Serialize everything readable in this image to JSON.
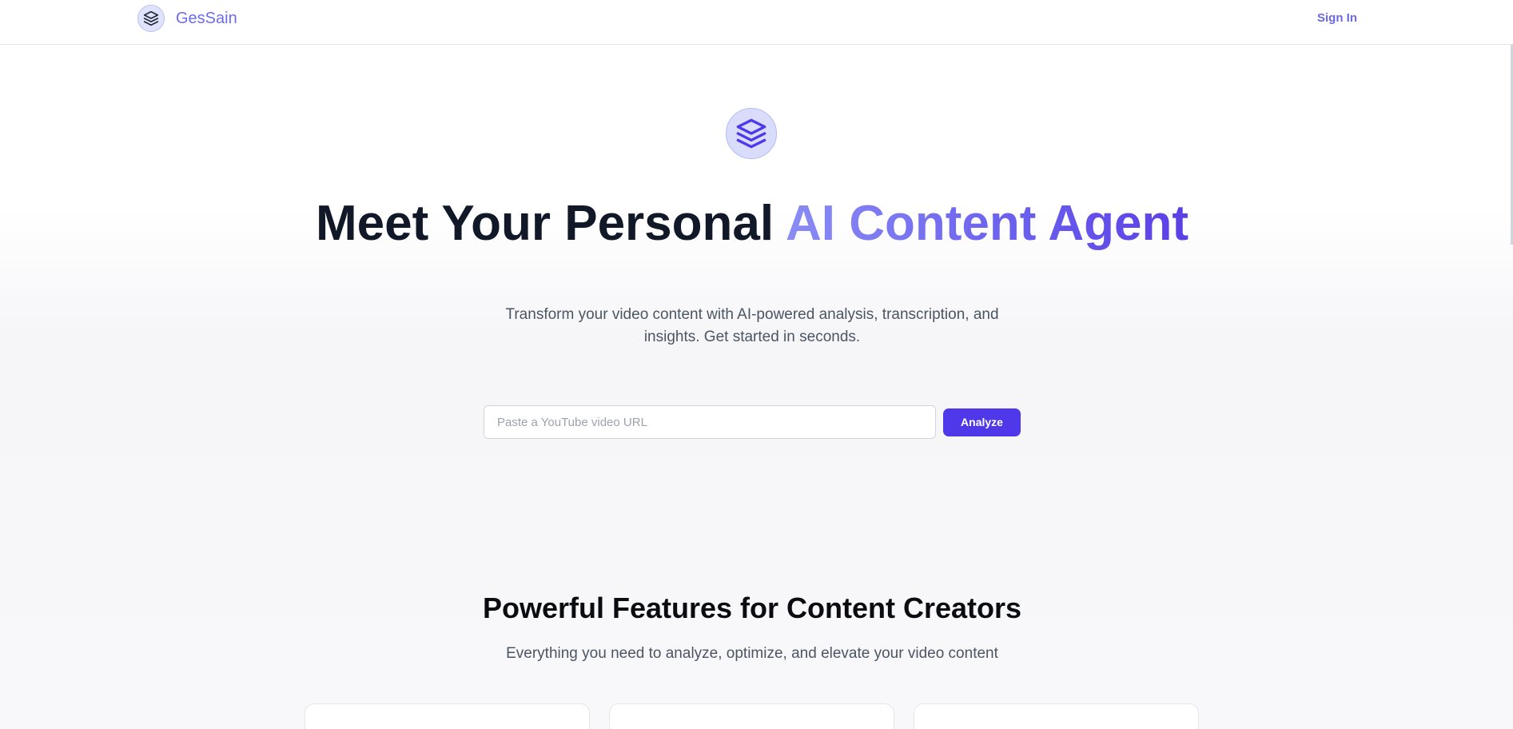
{
  "header": {
    "brand_name": "GesSain",
    "sign_in_label": "Sign In"
  },
  "hero": {
    "title_main": "Meet Your Personal ",
    "title_accent": "AI Content Agent",
    "subtitle": "Transform your video content with AI-powered analysis, transcription, and insights. Get started in seconds.",
    "url_placeholder": "Paste a YouTube video URL",
    "url_value": "",
    "analyze_label": "Analyze"
  },
  "features": {
    "title": "Powerful Features for Content Creators",
    "subtitle": "Everything you need to analyze, optimize, and elevate your video content"
  },
  "icons": {
    "brand_logo": "layers-icon",
    "hero_icon": "layers-icon"
  },
  "colors": {
    "accent": "#4f38ea",
    "brand_text": "#6d6cf0",
    "title_text": "#111827",
    "accent_gradient_start": "#8b8cf5",
    "accent_gradient_end": "#5b3fe6"
  }
}
